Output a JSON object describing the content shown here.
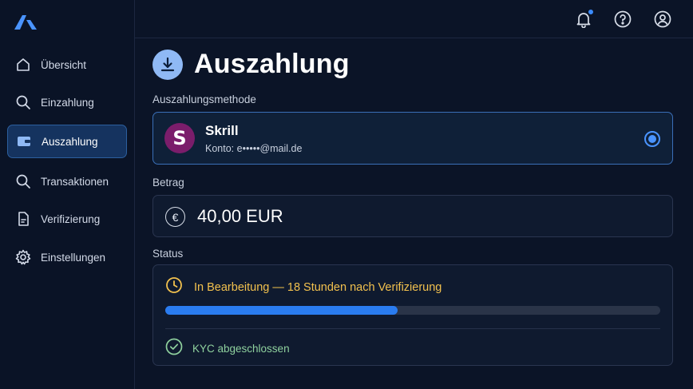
{
  "colors": {
    "background": "#0b1427",
    "accent": "#2a7cf0",
    "active_nav": "#15335f",
    "pending": "#f2c14e",
    "success": "#8fd19e",
    "skrill_brand": "#7b1d6b"
  },
  "sidebar": {
    "logo_icon": "brand-logo-icon",
    "items": [
      {
        "label": "Übersicht",
        "icon": "home-icon",
        "active": false
      },
      {
        "label": "Einzahlung",
        "icon": "search-icon",
        "active": false
      },
      {
        "label": "Auszahlung",
        "icon": "wallet-icon",
        "active": true
      },
      {
        "label": "Transaktionen",
        "icon": "search-icon",
        "active": false
      },
      {
        "label": "Verifizierung",
        "icon": "document-icon",
        "active": false
      },
      {
        "label": "Einstellungen",
        "icon": "gear-icon",
        "active": false
      }
    ]
  },
  "topbar": {
    "icons": [
      "bell-icon",
      "help-icon",
      "user-icon"
    ],
    "has_notification": true
  },
  "page": {
    "title": "Auszahlung",
    "title_icon": "download-icon"
  },
  "method": {
    "section_label": "Auszahlungsmethode",
    "name": "Skrill",
    "logo_letter": "S",
    "account": "Konto: e•••••@mail.de",
    "selected": true
  },
  "amount": {
    "section_label": "Betrag",
    "value": "40,00 EUR",
    "currency_symbol": "€"
  },
  "status": {
    "section_label": "Status",
    "text": "In Bearbeitung — 18 Stunden nach Verifizierung",
    "progress": 0.47,
    "kyc_text": "KYC abgeschlossen"
  }
}
